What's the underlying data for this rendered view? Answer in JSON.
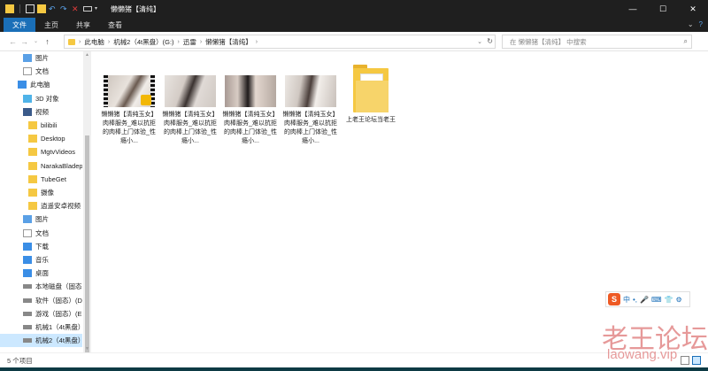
{
  "window": {
    "title": "懒懒猪【清纯】"
  },
  "ribbon": {
    "tabs": [
      "文件",
      "主页",
      "共享",
      "查看"
    ]
  },
  "address": {
    "crumbs": [
      "此电脑",
      "机械2（4t黑盘）(G:)",
      "迅雷",
      "懒懒猪【清纯】"
    ],
    "search_placeholder": "在 懒懒猪【清纯】 中搜索"
  },
  "sidebar": {
    "items": [
      {
        "label": "图片",
        "icon": "pictures-icon",
        "indent": 2
      },
      {
        "label": "文档",
        "icon": "documents-icon",
        "indent": 2
      },
      {
        "label": "此电脑",
        "icon": "pc-icon",
        "indent": 1
      },
      {
        "label": "3D 对象",
        "icon": "3d-objects-icon",
        "indent": 2
      },
      {
        "label": "视频",
        "icon": "videos-icon",
        "indent": 2
      },
      {
        "label": "bilibili",
        "icon": "folder-icon",
        "indent": 3
      },
      {
        "label": "Desktop",
        "icon": "folder-icon",
        "indent": 3
      },
      {
        "label": "MgtvVideos",
        "icon": "folder-icon",
        "indent": 3
      },
      {
        "label": "NarakaBladepoint",
        "icon": "folder-icon",
        "indent": 3
      },
      {
        "label": "TubeGet",
        "icon": "folder-icon",
        "indent": 3
      },
      {
        "label": "摄像",
        "icon": "folder-icon",
        "indent": 3
      },
      {
        "label": "逍遥安卓视频",
        "icon": "folder-icon",
        "indent": 3
      },
      {
        "label": "图片",
        "icon": "pictures-icon",
        "indent": 2
      },
      {
        "label": "文档",
        "icon": "documents-icon",
        "indent": 2
      },
      {
        "label": "下载",
        "icon": "downloads-icon",
        "indent": 2
      },
      {
        "label": "音乐",
        "icon": "music-icon",
        "indent": 2
      },
      {
        "label": "桌面",
        "icon": "desktop-icon",
        "indent": 2
      },
      {
        "label": "本地磁盘（固态）",
        "icon": "drive-icon",
        "indent": 2
      },
      {
        "label": "软件（固态）(D",
        "icon": "drive-icon",
        "indent": 2
      },
      {
        "label": "游戏（固态）(E",
        "icon": "drive-icon",
        "indent": 2
      },
      {
        "label": "机械1（4t黑盘）",
        "icon": "drive-icon",
        "indent": 2
      },
      {
        "label": "机械2（4t黑盘）",
        "icon": "drive-icon",
        "indent": 2,
        "selected": true
      }
    ]
  },
  "files": [
    {
      "name": "懒懒猪【清纯玉女】肉棒服务_难以抗拒的肉棒上门体验_性瘾小...",
      "type": "video"
    },
    {
      "name": "懒懒猪【清纯玉女】肉棒服务_难以抗拒的肉棒上门体验_性瘾小...",
      "type": "video"
    },
    {
      "name": "懒懒猪【清纯玉女】肉棒服务_难以抗拒的肉棒上门体验_性瘾小...",
      "type": "video"
    },
    {
      "name": "懒懒猪【清纯玉女】肉棒服务_难以抗拒的肉棒上门体验_性瘾小...",
      "type": "video"
    },
    {
      "name": "上老王论坛当老王",
      "type": "folder"
    }
  ],
  "status": {
    "count": "5 个项目"
  },
  "ime": {
    "logo": "S",
    "items": [
      "中",
      "•,",
      "🎤",
      "⌨",
      "👕",
      "⚙"
    ]
  },
  "watermark": {
    "line1": "老王论坛",
    "line2": "laowang.vip"
  },
  "colors": {
    "accent": "#1a6fb8",
    "folder": "#f5c842",
    "titlebar": "#1f1f1f"
  }
}
